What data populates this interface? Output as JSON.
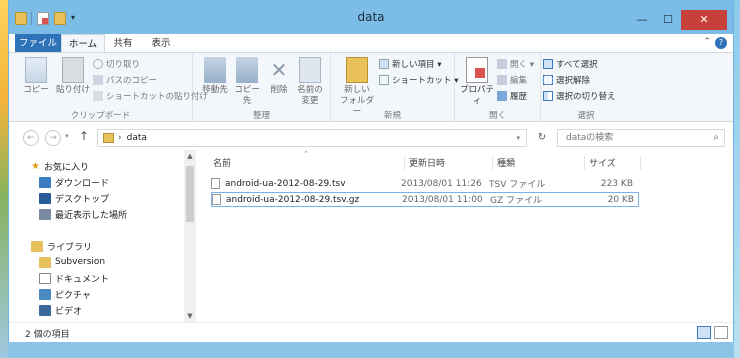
{
  "window": {
    "title": "data"
  },
  "controls": {
    "minimize": "—",
    "maximize": "☐",
    "close": "✕"
  },
  "tabs": {
    "file": "ファイル",
    "home": "ホーム",
    "share": "共有",
    "view": "表示"
  },
  "ribbon": {
    "clipboard": {
      "label": "クリップボード",
      "copy": "コピー",
      "paste": "貼り付け",
      "cut": "切り取り",
      "copy_path": "パスのコピー",
      "paste_shortcut": "ショートカットの貼り付け"
    },
    "organize": {
      "label": "整理",
      "move_to": "移動先",
      "copy_to": "コピー先",
      "delete": "削除",
      "rename": "名前の\n変更"
    },
    "new": {
      "label": "新規",
      "new_folder": "新しい\nフォルダー",
      "new_item": "新しい項目 ▾",
      "easy_access": "ショートカット ▾"
    },
    "open": {
      "label": "開く",
      "properties": "プロパティ",
      "open": "開く ▾",
      "edit": "編集",
      "history": "履歴"
    },
    "select": {
      "label": "選択",
      "select_all": "すべて選択",
      "select_none": "選択解除",
      "invert": "選択の切り替え"
    }
  },
  "address": {
    "path": "data",
    "search_placeholder": "dataの検索"
  },
  "nav": {
    "favorites": "お気に入り",
    "downloads": "ダウンロード",
    "desktop": "デスクトップ",
    "recent": "最近表示した場所",
    "libraries": "ライブラリ",
    "subversion": "Subversion",
    "documents": "ドキュメント",
    "pictures": "ピクチャ",
    "videos": "ビデオ"
  },
  "columns": {
    "name": "名前",
    "date": "更新日時",
    "type": "種類",
    "size": "サイズ"
  },
  "files": [
    {
      "name": "android-ua-2012-08-29.tsv",
      "date": "2013/08/01 11:26",
      "type": "TSV ファイル",
      "size": "223 KB"
    },
    {
      "name": "android-ua-2012-08-29.tsv.gz",
      "date": "2013/08/01 11:00",
      "type": "GZ ファイル",
      "size": "20 KB"
    }
  ],
  "status": {
    "count": "2 個の項目"
  },
  "colors": {
    "titlebar": "#7cbde8",
    "file_tab": "#2e73b8",
    "close": "#c7403a",
    "selection": "#cce8ff"
  }
}
